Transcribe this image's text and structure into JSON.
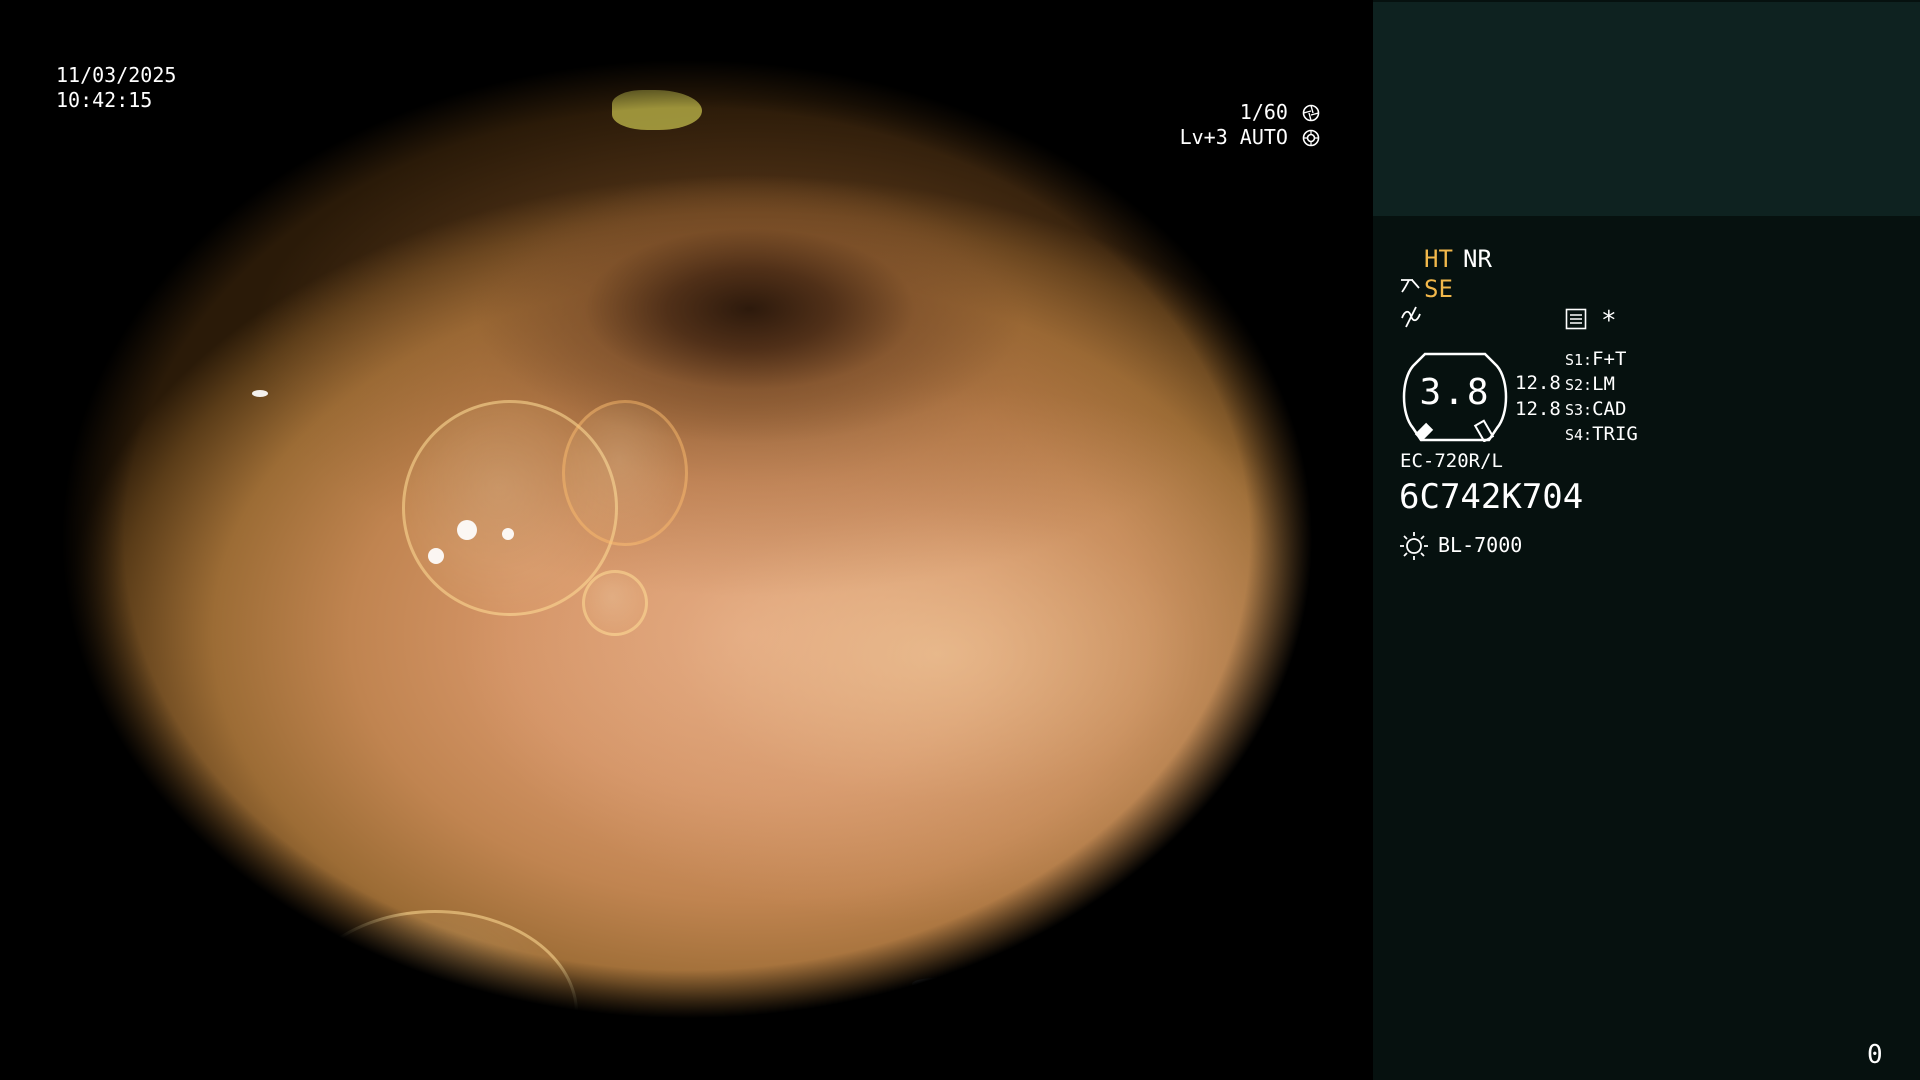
{
  "video": {
    "date": "11/03/2025",
    "time": "10:42:15",
    "shutter": "1/60",
    "shutter_icon": "aperture-icon",
    "iris_level": "Lv+3 AUTO",
    "iris_icon": "iris-icon"
  },
  "panel": {
    "ht_label": "HT",
    "nr_label": "NR",
    "se_label": "SE",
    "gauge_value": "3.8",
    "gauge_side_values": [
      "12.8",
      "12.8"
    ],
    "switches": [
      {
        "key": "S1:",
        "value": "F+T"
      },
      {
        "key": "S2:",
        "value": "LM"
      },
      {
        "key": "S3:",
        "value": "CAD"
      },
      {
        "key": "S4:",
        "value": "TRIG"
      }
    ],
    "scope_model": "EC-720R/L",
    "scope_serial": "6C742K704",
    "light_source": "BL-7000",
    "star": "*"
  },
  "footer": {
    "counter": "0"
  },
  "colors": {
    "panel_bg": "#06110f",
    "panel_top_bg": "#0e2220",
    "accent": "#f2b84b",
    "text": "#ffffff"
  }
}
